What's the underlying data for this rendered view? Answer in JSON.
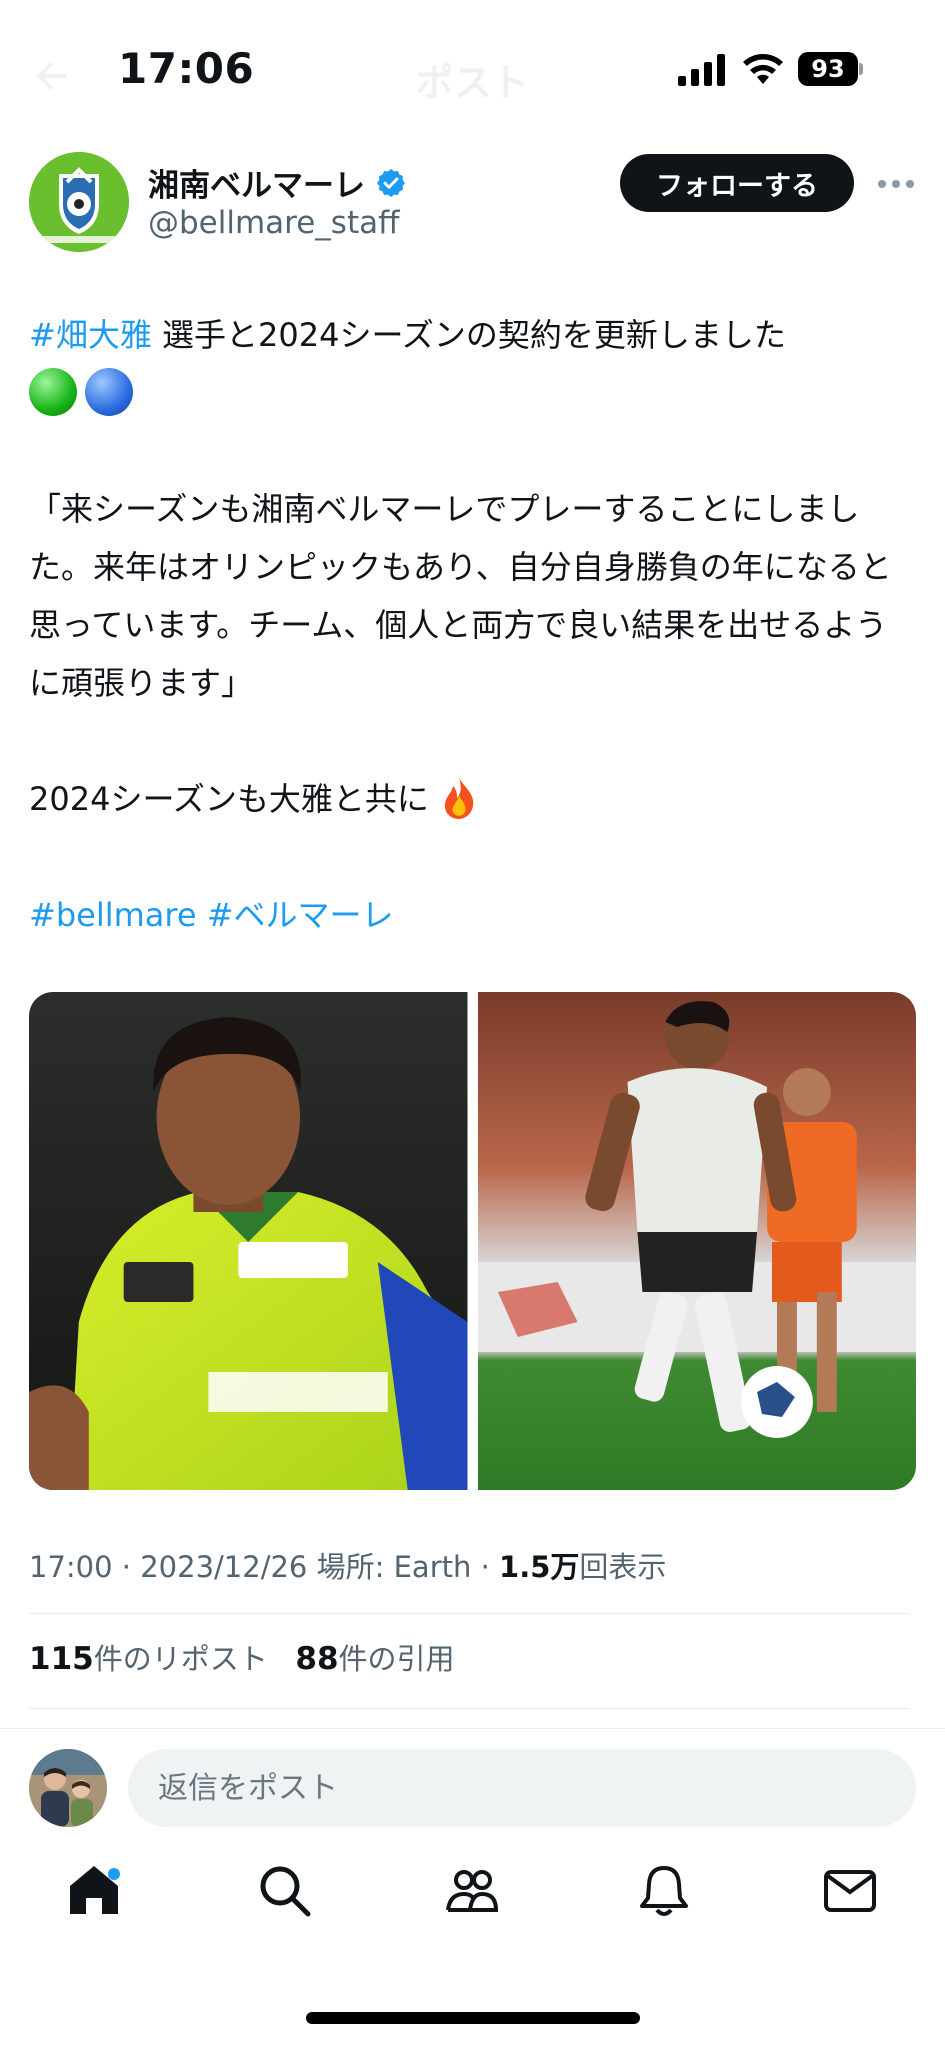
{
  "status_bar": {
    "time": "17:06",
    "battery": "93",
    "screen_title": "ポスト"
  },
  "author": {
    "display_name": "湘南ベルマーレ",
    "handle": "@bellmare_staff",
    "avatar_icon": "bellmare-crest-icon",
    "verified": true
  },
  "actions": {
    "follow_label": "フォローする",
    "more_icon": "more-dots-icon"
  },
  "tweet": {
    "hashtag_player": "#畑大雅",
    "line1_rest": " 選手と2024シーズンの契約を更新しました",
    "emoji_1": "green-circle-emoji",
    "emoji_2": "blue-circle-emoji",
    "quote": "「来シーズンも湘南ベルマーレでプレーすることにしました。来年はオリンピックもあり、自分自身勝負の年になると思っています。チーム、個人と両方で良い結果を出せるように頑張ります」",
    "closing": "2024シーズンも大雅と共に",
    "closing_emoji": "fire-emoji",
    "hashtag_1": "#bellmare",
    "hashtag_2": "#ベルマーレ"
  },
  "media": [
    {
      "description_icon": "player-portrait-photo"
    },
    {
      "description_icon": "player-dribbling-photo"
    }
  ],
  "meta": {
    "time": "17:00",
    "date": "2023/12/26",
    "location_label": "場所: Earth",
    "views_count": "1.5万",
    "views_label": "回表示"
  },
  "stats": {
    "reposts_count": "115",
    "reposts_label": "件のリポスト",
    "quotes_count": "88",
    "quotes_label": "件の引用"
  },
  "reply": {
    "placeholder": "返信をポスト"
  },
  "tabs": [
    {
      "icon": "home-icon"
    },
    {
      "icon": "search-icon"
    },
    {
      "icon": "communities-icon"
    },
    {
      "icon": "notifications-icon"
    },
    {
      "icon": "messages-icon"
    }
  ],
  "colors": {
    "link": "#1d9bf0",
    "text": "#0f1419",
    "muted": "#536471",
    "follow_bg": "#0f1419"
  }
}
